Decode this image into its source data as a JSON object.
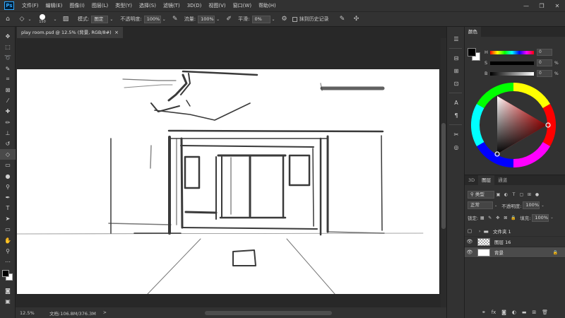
{
  "app": {
    "logo": "Ps"
  },
  "menu": [
    "文件(F)",
    "编辑(E)",
    "图像(I)",
    "图层(L)",
    "类型(Y)",
    "选择(S)",
    "滤镜(T)",
    "3D(D)",
    "视图(V)",
    "窗口(W)",
    "帮助(H)"
  ],
  "window_controls": {
    "minimize": "—",
    "restore": "❐",
    "close": "✕"
  },
  "options": {
    "brush_size": "150",
    "mode_label": "模式:",
    "mode_value": "图定",
    "opacity_label": "不透明度:",
    "opacity_value": "100%",
    "flow_label": "流量:",
    "flow_value": "100%",
    "smoothing_label": "平滑:",
    "smoothing_value": "0%",
    "erase_history_label": "抹到历史记录"
  },
  "document": {
    "tab_title": "play room.psd @ 12.5% (背景, RGB/8#)",
    "close": "×"
  },
  "status": {
    "zoom": "12.5%",
    "doc_info": "文档:106.8M/376.3M",
    "arrow": ">"
  },
  "color_panel": {
    "tab": "颜色",
    "sliders": [
      {
        "label": "H",
        "value": "0",
        "unit": ""
      },
      {
        "label": "S",
        "value": "0",
        "unit": "%"
      },
      {
        "label": "B",
        "value": "0",
        "unit": "%"
      }
    ]
  },
  "layers_panel": {
    "tabs": [
      "3D",
      "图层",
      "通道"
    ],
    "active_tab": "图层",
    "filter_label": "类型",
    "blend_mode": "正常",
    "opacity_label": "不透明度:",
    "opacity_value": "100%",
    "lock_label": "锁定:",
    "fill_label": "填充:",
    "fill_value": "100%",
    "layers": [
      {
        "name": "文件夹 1",
        "visible": false,
        "kind": "group"
      },
      {
        "name": "图层 16",
        "visible": true,
        "kind": "pixel"
      },
      {
        "name": "背景",
        "visible": true,
        "kind": "background",
        "locked": true
      }
    ]
  },
  "colors": {
    "accent": "#31a8ff",
    "foreground": "#000000",
    "background": "#ffffff",
    "panel": "#323232",
    "workspace": "#282828"
  }
}
